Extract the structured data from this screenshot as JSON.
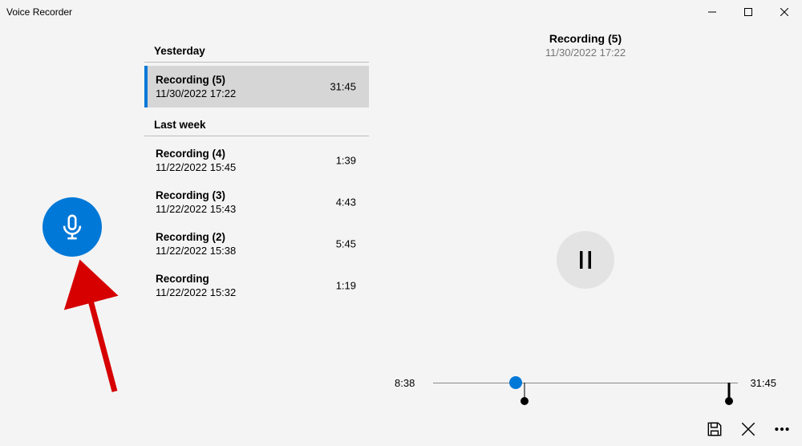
{
  "window": {
    "title": "Voice Recorder"
  },
  "groups": [
    {
      "header": "Yesterday",
      "items": [
        {
          "title": "Recording (5)",
          "sub": "11/30/2022 17:22",
          "dur": "31:45",
          "selected": true
        }
      ]
    },
    {
      "header": "Last week",
      "items": [
        {
          "title": "Recording (4)",
          "sub": "11/22/2022 15:45",
          "dur": "1:39"
        },
        {
          "title": "Recording (3)",
          "sub": "11/22/2022 15:43",
          "dur": "4:43"
        },
        {
          "title": "Recording (2)",
          "sub": "11/22/2022 15:38",
          "dur": "5:45"
        },
        {
          "title": "Recording",
          "sub": "11/22/2022 15:32",
          "dur": "1:19"
        }
      ]
    }
  ],
  "player": {
    "title": "Recording (5)",
    "sub": "11/30/2022 17:22",
    "pos": "8:38",
    "total": "31:45",
    "thumb_pct": 27,
    "markers_pct": [
      30,
      97
    ]
  }
}
